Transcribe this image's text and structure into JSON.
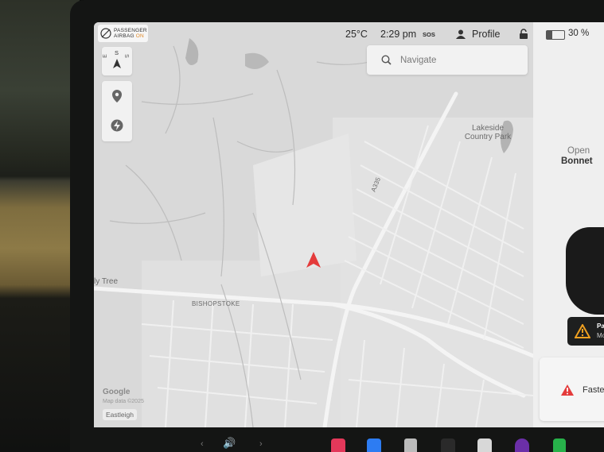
{
  "status_bar": {
    "airbag_line1": "PASSENGER",
    "airbag_line2": "AIRBAG",
    "airbag_state": "ON",
    "temperature": "25°C",
    "time": "2:29 pm",
    "sos": "SOS",
    "profile_label": "Profile",
    "battery_percent": "30 %",
    "battery_level": 0.3
  },
  "search": {
    "placeholder": "Navigate"
  },
  "compass": {
    "labels": [
      "E",
      "S",
      "S"
    ]
  },
  "map": {
    "labels": {
      "lakeside": "Lakeside\nCountry Park",
      "road": "A335",
      "tree": "ly Tree",
      "bishopstoke": "BISHOPSTOKE"
    },
    "google": "Google",
    "copyright": "Map data ©2025",
    "eastleigh": "Eastleigh"
  },
  "right_panel": {
    "open_label": "Open",
    "bonnet_label": "Bonnet",
    "alert1_title": "Pa",
    "alert1_sub": "Mo",
    "alert2_text": "Faste"
  },
  "colors": {
    "accent_red": "#e43b3b",
    "airbag_on": "#e08a2a",
    "map_bg": "#d9d9d9"
  },
  "icons": {
    "airbag": "airbag-off-icon",
    "sos": "sos-icon",
    "profile": "person-icon",
    "lock": "lock-icon",
    "battery": "battery-icon",
    "search": "search-icon",
    "pin": "location-pin-icon",
    "charge": "lightning-icon",
    "car": "car-arrow-icon",
    "warning": "warning-icon"
  }
}
